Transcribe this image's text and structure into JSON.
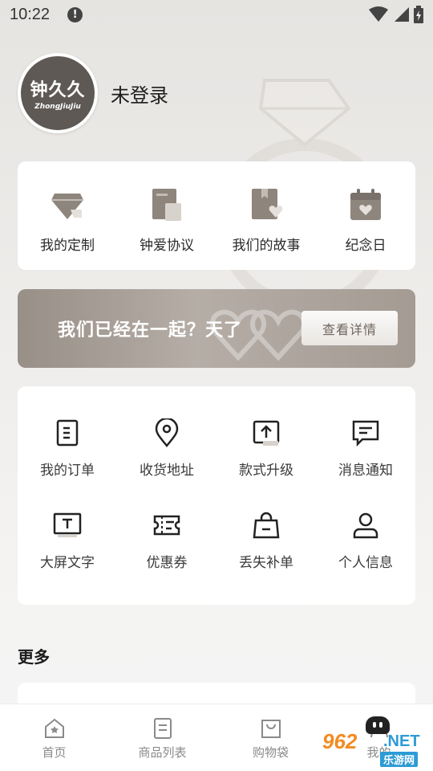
{
  "status_bar": {
    "time": "10:22"
  },
  "profile": {
    "avatar_brand_cn": "钟久久",
    "avatar_brand_en": "ZhongJiuJiu",
    "login_status": "未登录"
  },
  "quick_links": [
    {
      "label": "我的定制",
      "icon": "diamond-icon"
    },
    {
      "label": "钟爱协议",
      "icon": "agreement-icon"
    },
    {
      "label": "我们的故事",
      "icon": "story-book-icon"
    },
    {
      "label": "纪念日",
      "icon": "calendar-heart-icon"
    }
  ],
  "banner": {
    "text": "我们已经在一起？天了",
    "button_label": "查看详情"
  },
  "services": [
    {
      "label": "我的订单",
      "icon": "order-icon"
    },
    {
      "label": "收货地址",
      "icon": "location-pin-icon"
    },
    {
      "label": "款式升级",
      "icon": "upgrade-icon"
    },
    {
      "label": "消息通知",
      "icon": "message-icon"
    },
    {
      "label": "大屏文字",
      "icon": "large-text-icon"
    },
    {
      "label": "优惠券",
      "icon": "coupon-icon"
    },
    {
      "label": "丢失补单",
      "icon": "lost-bag-icon"
    },
    {
      "label": "个人信息",
      "icon": "person-icon"
    }
  ],
  "more": {
    "title": "更多"
  },
  "tabbar": [
    {
      "label": "首页",
      "icon": "home-icon"
    },
    {
      "label": "商品列表",
      "icon": "list-icon"
    },
    {
      "label": "购物袋",
      "icon": "bag-icon"
    },
    {
      "label": "我的",
      "icon": "profile-icon"
    }
  ],
  "watermark": {
    "number": "962",
    "suffix": ".NET",
    "sub": "乐游网"
  }
}
